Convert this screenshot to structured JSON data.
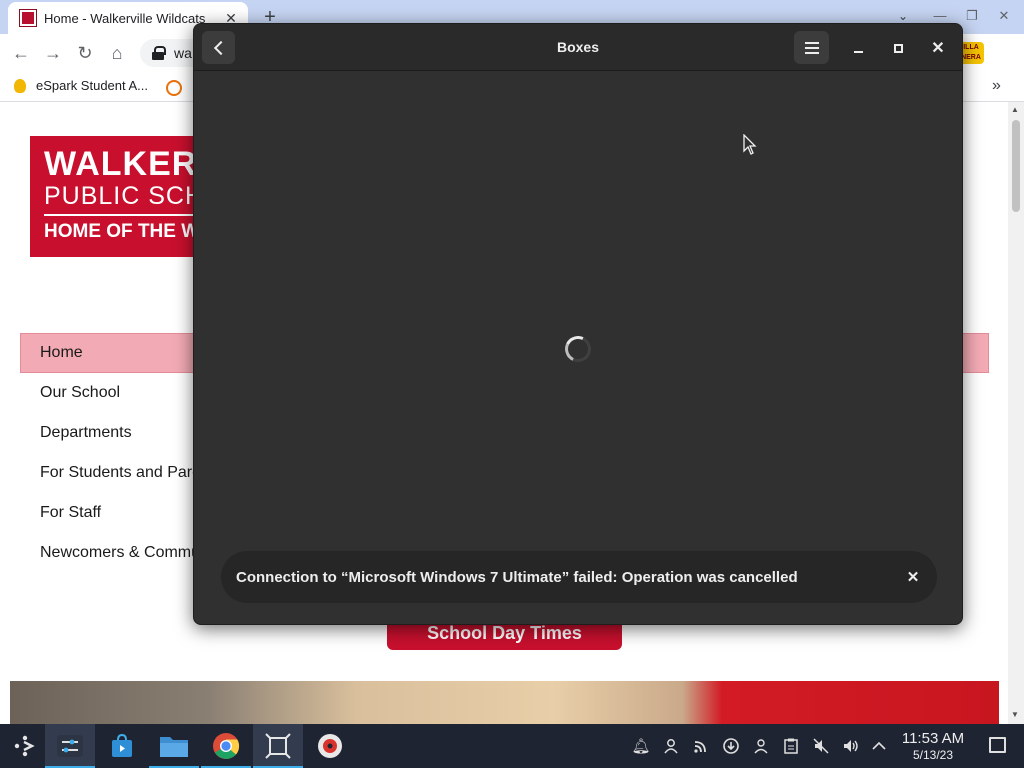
{
  "browser": {
    "tab_title": "Home - Walkerville Wildcats",
    "tab_close": "✕",
    "new_tab": "+",
    "url": "wa",
    "bookmark_label": "eSpark Student A...",
    "bookmark_more": "»",
    "extension_text": "ILLA NERA"
  },
  "website": {
    "logo_line1": "WALKERVILLE",
    "logo_line2": "PUBLIC SCHOOL",
    "logo_line3": "HOME OF THE WILDCATS",
    "nav": [
      "Home",
      "Our School",
      "Departments",
      "For Students and Parents",
      "For Staff",
      "Newcomers & Community"
    ],
    "school_day_button": "School Day Times"
  },
  "dialog": {
    "title": "Boxes",
    "toast_message": "Connection to “Microsoft Windows 7 Ultimate” failed: Operation was cancelled",
    "toast_close": "✕",
    "window_close": "✕"
  },
  "taskbar": {
    "time": "11:53 AM",
    "date": "5/13/23"
  },
  "colors": {
    "brand_red": "#c8102e",
    "nav_active": "#f2aab4",
    "dialog_bg": "#303030",
    "taskbar_bg": "#1f2432"
  }
}
